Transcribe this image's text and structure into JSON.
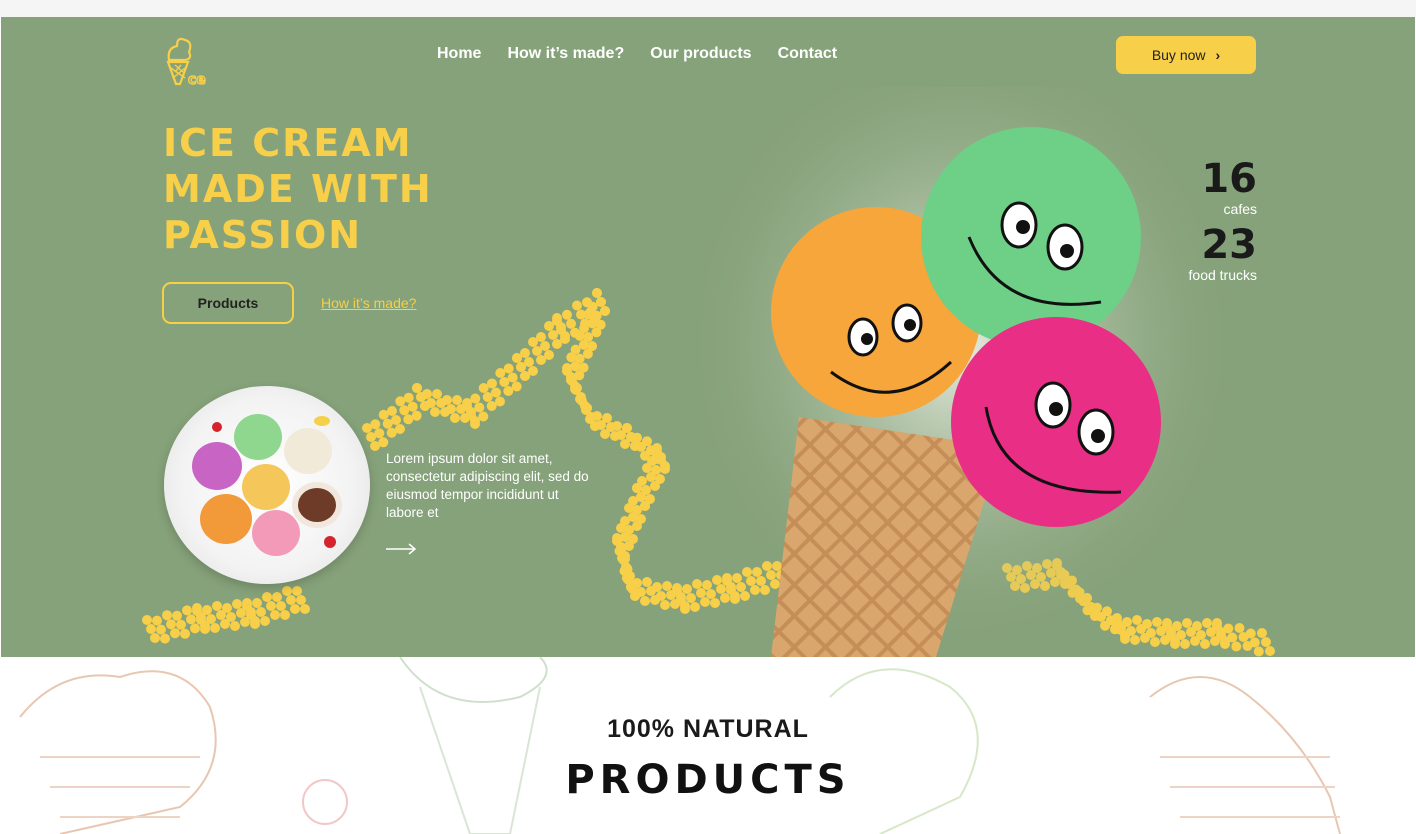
{
  "nav": {
    "items": [
      "Home",
      "How it’s made?",
      "Our products",
      "Contact"
    ],
    "buy_label": "Buy now"
  },
  "hero": {
    "headline": "ICE CREAM MADE WITH PASSION",
    "products_button": "Products",
    "how_link": "How it’s made?",
    "lorem": "Lorem ipsum dolor sit amet, consectetur adipiscing elit, sed do eiusmod tempor incididunt ut labore et"
  },
  "stats": [
    {
      "value": "16",
      "label": "cafes"
    },
    {
      "value": "23",
      "label": "food trucks"
    }
  ],
  "section": {
    "subtitle": "100% NATURAL",
    "title": "PRODUCTS"
  },
  "colors": {
    "hero_bg": "#86a27a",
    "accent_yellow": "#f7cf49"
  },
  "icons": [
    "ice-cream-logo-icon",
    "chevron-right-icon",
    "arrow-right-icon"
  ]
}
